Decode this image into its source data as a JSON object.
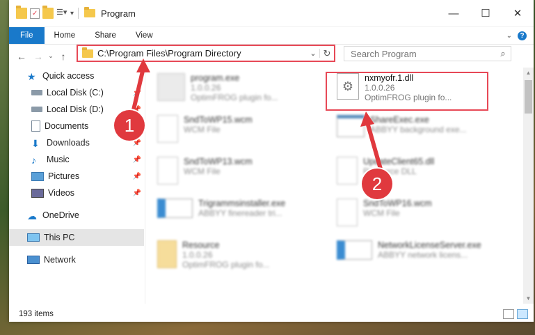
{
  "window": {
    "title": "Program",
    "controls": {
      "minimize": "—",
      "maximize": "☐",
      "close": "✕"
    }
  },
  "ribbon": {
    "tabs": [
      "File",
      "Home",
      "Share",
      "View"
    ]
  },
  "address_bar": {
    "path": "C:\\Program Files\\Program Directory"
  },
  "search": {
    "placeholder": "Search Program"
  },
  "sidebar": {
    "items": [
      {
        "label": "Quick access",
        "icon": "star-icon"
      },
      {
        "label": "Local Disk (C:)",
        "icon": "drive-icon"
      },
      {
        "label": "Local Disk (D:)",
        "icon": "drive-icon"
      },
      {
        "label": "Documents",
        "icon": "documents-icon"
      },
      {
        "label": "Downloads",
        "icon": "download-icon"
      },
      {
        "label": "Music",
        "icon": "music-icon"
      },
      {
        "label": "Pictures",
        "icon": "pictures-icon"
      },
      {
        "label": "Videos",
        "icon": "videos-icon"
      },
      {
        "label": "OneDrive",
        "icon": "cloud-icon"
      },
      {
        "label": "This PC",
        "icon": "computer-icon"
      },
      {
        "label": "Network",
        "icon": "network-icon"
      }
    ]
  },
  "files": [
    {
      "name": "program.exe",
      "meta1": "1.0.0.26",
      "meta2": "OptimFROG plugin fo..."
    },
    {
      "name": "nxmyofr.1.dll",
      "meta1": "1.0.0.26",
      "meta2": "OptimFROG plugin fo..."
    },
    {
      "name": "SndToWP15.wcm",
      "meta1": "WCM File",
      "meta2": ""
    },
    {
      "name": "ShareExec.exe",
      "meta1": "ABBYY background exe...",
      "meta2": ""
    },
    {
      "name": "SndToWP13.wcm",
      "meta1": "WCM File",
      "meta2": ""
    },
    {
      "name": "UpdateClient65.dll",
      "meta1": "Resource DLL",
      "meta2": ""
    },
    {
      "name": "Trigrammsinstaller.exe",
      "meta1": "ABBYY finereader tri...",
      "meta2": ""
    },
    {
      "name": "SndToWP16.wcm",
      "meta1": "WCM File",
      "meta2": ""
    },
    {
      "name": "Resource",
      "meta1": "1.0.0.26",
      "meta2": "OptimFROG plugin fo..."
    },
    {
      "name": "NetworkLicenseServer.exe",
      "meta1": "ABBYY network licens...",
      "meta2": ""
    }
  ],
  "annotations": {
    "step1": "1",
    "step2": "2"
  },
  "status": {
    "item_count": "193 items"
  },
  "colors": {
    "accent": "#1979ca",
    "highlight": "#e74856"
  }
}
